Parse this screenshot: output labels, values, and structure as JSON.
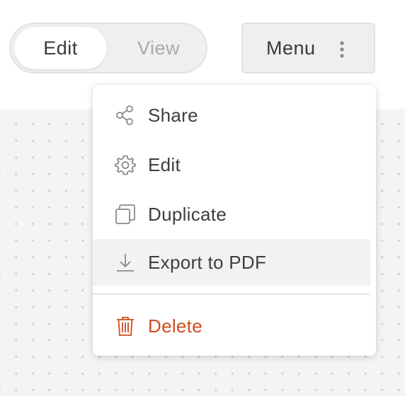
{
  "mode_toggle": {
    "options": [
      {
        "label": "Edit",
        "active": true
      },
      {
        "label": "View",
        "active": false
      }
    ]
  },
  "menu_button": {
    "label": "Menu",
    "icon": "kebab-icon"
  },
  "dropdown": {
    "items": [
      {
        "label": "Share",
        "icon": "share-icon"
      },
      {
        "label": "Edit",
        "icon": "gear-icon"
      },
      {
        "label": "Duplicate",
        "icon": "duplicate-icon"
      },
      {
        "label": "Export to PDF",
        "icon": "download-icon",
        "highlighted": true
      },
      {
        "label": "Delete",
        "icon": "trash-icon",
        "danger": true
      }
    ]
  },
  "colors": {
    "danger": "#cf4d1f",
    "text": "#3e3e3e",
    "muted": "#a9a9a9",
    "icon": "#8a8a8a",
    "hover": "#f2f2f2"
  }
}
